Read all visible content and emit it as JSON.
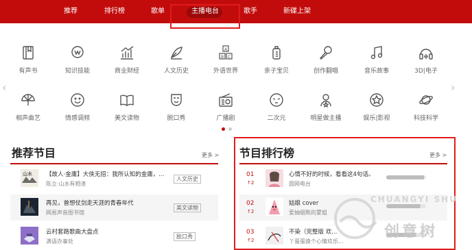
{
  "nav": {
    "items": [
      {
        "label": "推荐"
      },
      {
        "label": "排行榜"
      },
      {
        "label": "歌单"
      },
      {
        "label": "主播电台"
      },
      {
        "label": "歌手"
      },
      {
        "label": "新碟上架"
      }
    ],
    "active_index": 3
  },
  "categories": {
    "row1": [
      {
        "label": "有声书",
        "icon": "book-icon"
      },
      {
        "label": "知识技能",
        "icon": "lightbulb-icon"
      },
      {
        "label": "商业财经",
        "icon": "chart-icon"
      },
      {
        "label": "人文历史",
        "icon": "quill-icon"
      },
      {
        "label": "外语世界",
        "icon": "abc-blocks-icon"
      },
      {
        "label": "亲子宝贝",
        "icon": "baby-bottle-icon"
      },
      {
        "label": "创作翻唱",
        "icon": "microphone-icon"
      },
      {
        "label": "音乐故事",
        "icon": "music-note-icon"
      },
      {
        "label": "3D|电子",
        "icon": "headphones-icon"
      }
    ],
    "row2": [
      {
        "label": "相声曲艺",
        "icon": "fan-icon"
      },
      {
        "label": "情感调频",
        "icon": "smiley-icon"
      },
      {
        "label": "美文读物",
        "icon": "open-book-icon"
      },
      {
        "label": "脱口秀",
        "icon": "mask-icon"
      },
      {
        "label": "广播剧",
        "icon": "radio-icon"
      },
      {
        "label": "二次元",
        "icon": "anime-face-icon"
      },
      {
        "label": "明星做主播",
        "icon": "star-person-icon"
      },
      {
        "label": "娱乐|影视",
        "icon": "star-badge-icon"
      },
      {
        "label": "科技科学",
        "icon": "planet-icon"
      }
    ]
  },
  "carousel": {
    "pages": 2,
    "current": 1
  },
  "recommend": {
    "title": "推荐节目",
    "more": "更多 >",
    "items": [
      {
        "title": "【故人·金庸】大侠无招：我所认知的金庸，...",
        "sub": "陈立·山水有相逢",
        "tag": "人文历史"
      },
      {
        "title": "再见，曾想仗剑走天涯的青春年代",
        "sub": "网易声音图书馆",
        "tag": "美文读物"
      },
      {
        "title": "云村套路歌曲大盘点",
        "sub": "满语办事处",
        "tag": "脱口秀"
      }
    ]
  },
  "ranking": {
    "title": "节目排行榜",
    "more": "更多 >",
    "items": [
      {
        "rank": "01",
        "move": "↑2",
        "title": "心情不好的时候，看看这4句话。",
        "sub": "圆网电台",
        "progress": 0.95
      },
      {
        "rank": "02",
        "move": "↑2",
        "title": "姑娘 cover",
        "sub": "爱抽烟熊的蒙姐",
        "progress": 0.85
      },
      {
        "rank": "03",
        "move": "↑2",
        "title": "不染（完整版 欢...",
        "sub": "丫蛋蛋换个心情欢乐...",
        "progress": 0.75
      }
    ]
  },
  "watermark": {
    "latin": "CHUANGYI SHU",
    "cn": "创意树"
  },
  "colors": {
    "brand_red": "#c20c0c",
    "highlight": "#e01b1b"
  }
}
